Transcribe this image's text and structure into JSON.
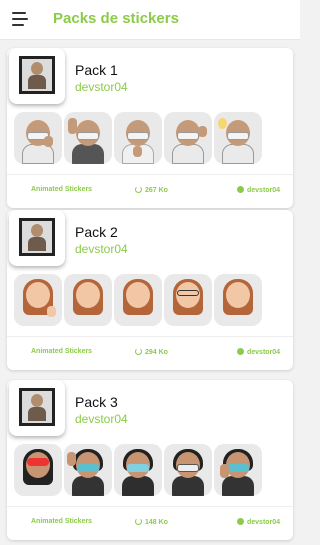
{
  "appbar": {
    "title": "Packs de stickers",
    "menu_icon": "hamburger-menu-icon"
  },
  "colors": {
    "accent": "#8ccb4a",
    "card_bg": "#ffffff",
    "page_bg": "#f2f2f2"
  },
  "packs": [
    {
      "name": "Pack 1",
      "author": "devstor04",
      "type_label": "Animated Stickers",
      "size": "267 Ko",
      "author_footer": "devstor04"
    },
    {
      "name": "Pack 2",
      "author": "devstor04",
      "type_label": "Animated Stickers",
      "size": "294 Ko",
      "author_footer": "devstor04"
    },
    {
      "name": "Pack 3",
      "author": "devstor04",
      "type_label": "Animated Stickers",
      "size": "148 Ko",
      "author_footer": "devstor04"
    }
  ]
}
